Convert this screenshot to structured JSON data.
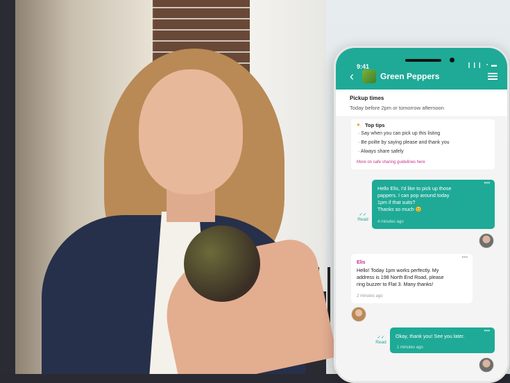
{
  "phone": {
    "status_time": "9:41",
    "status_icons": "❙❙❙ ◔ ▬",
    "header_title": "Green Peppers",
    "back_icon": "chevron-left-icon",
    "menu_icon": "hamburger-menu-icon"
  },
  "pickup": {
    "heading": "Pickup times",
    "text": "Today before 2pm or tomorrow afternoon"
  },
  "tips": {
    "heading": "Top tips",
    "items": [
      "· Say when you can pick up this listing",
      "· Be poilte by saying please and thank you",
      "· Always share safely"
    ],
    "link": "More on safe sharing guidelines here"
  },
  "messages": [
    {
      "direction": "out",
      "lines": [
        "Hello Elis, I'd like to pick up those",
        "pappers. I can pop around today",
        "1pm if that suits?",
        "Thanks so much 😊"
      ],
      "time": "4 minutes ago",
      "status": "Read"
    },
    {
      "direction": "in",
      "sender": "Elis",
      "lines": [
        "Hello! Today 1pm works perfectly. My",
        "address is 198 North End Road, please",
        "ring buzzer to Flat 3. Many thanks!"
      ],
      "time": "2 minutes ago"
    },
    {
      "direction": "out",
      "lines": [
        "Okay, thank you! See you later."
      ],
      "time": "1 minutes ago",
      "status": "Read"
    }
  ],
  "colors": {
    "brand_teal": "#1eaa96",
    "link_pink": "#c2318a"
  }
}
